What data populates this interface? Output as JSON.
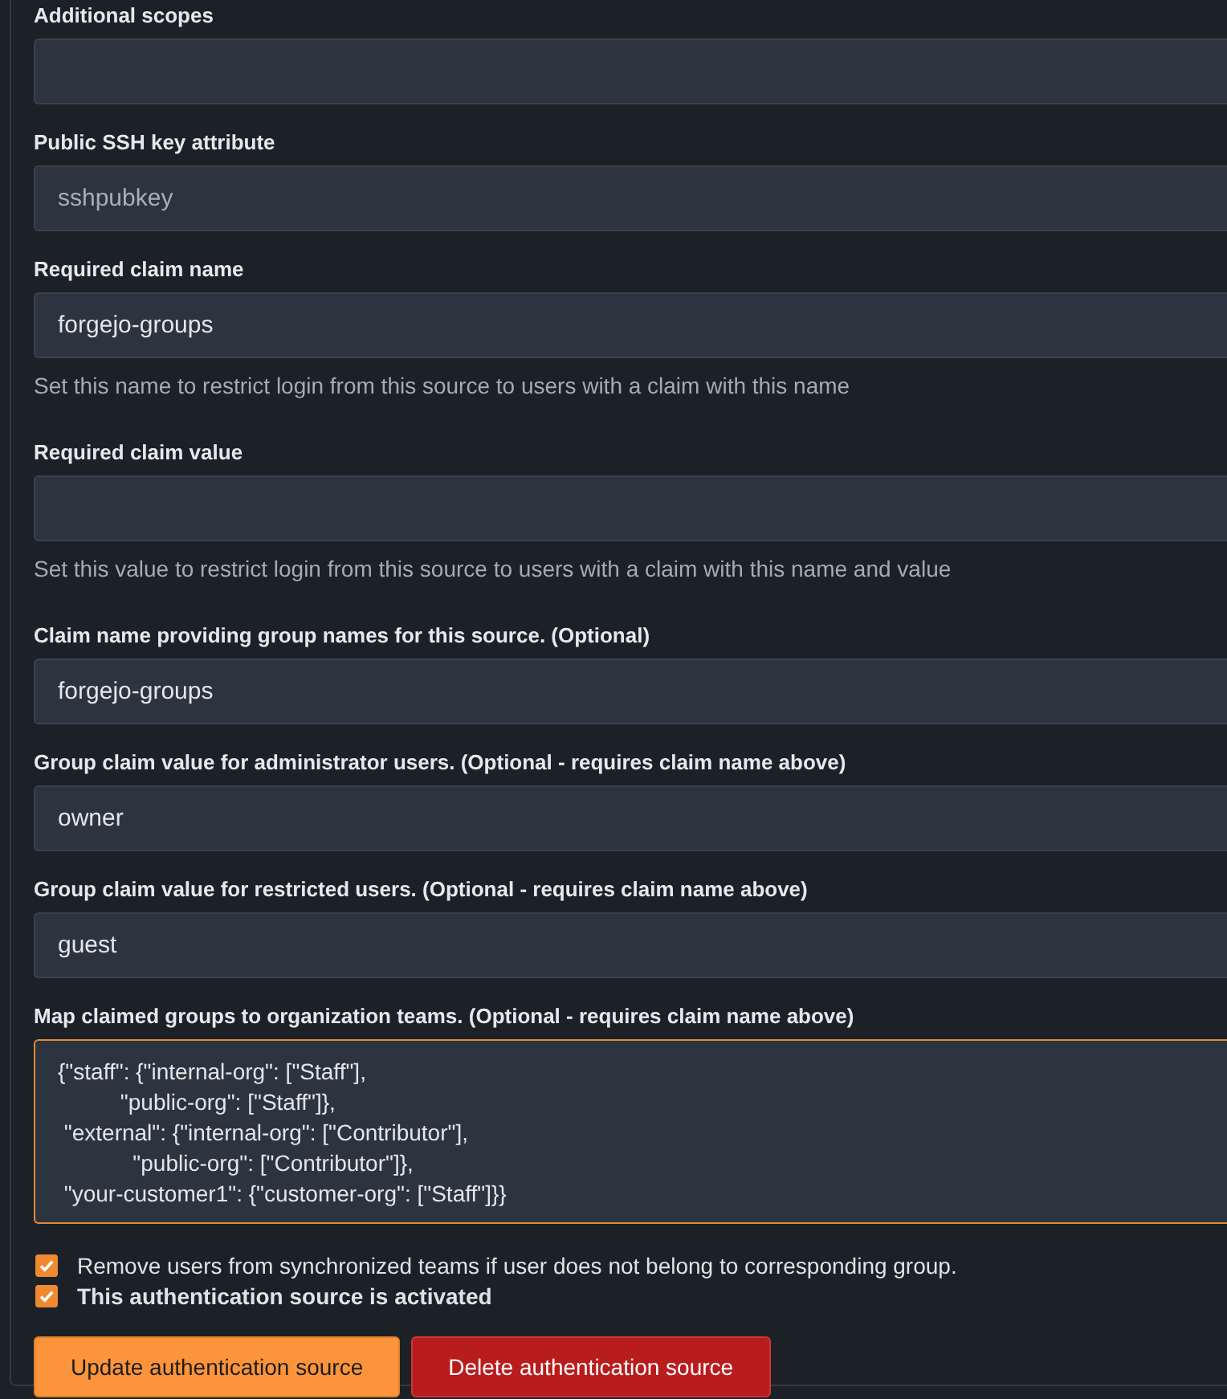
{
  "fields": [
    {
      "kind": "input",
      "label": "Additional scopes"
    },
    {
      "kind": "input",
      "label": "Public SSH key attribute",
      "placeholder": "sshpubkey"
    },
    {
      "kind": "input",
      "label": "Required claim name",
      "value": "forgejo-groups",
      "help": "Set this name to restrict login from this source to users with a claim with this name"
    },
    {
      "kind": "input",
      "label": "Required claim value",
      "help": "Set this value to restrict login from this source to users with a claim with this name and value"
    },
    {
      "kind": "input",
      "label": "Claim name providing group names for this source. (Optional)",
      "value": "forgejo-groups"
    },
    {
      "kind": "input",
      "label": "Group claim value for administrator users. (Optional - requires claim name above)",
      "value": "owner"
    },
    {
      "kind": "input",
      "label": "Group claim value for restricted users. (Optional - requires claim name above)",
      "value": "guest"
    },
    {
      "kind": "textarea",
      "label": "Map claimed groups to organization teams. (Optional - requires claim name above)",
      "focused": true,
      "value": "{\"staff\": {\"internal-org\": [\"Staff\"],\n          \"public-org\": [\"Staff\"]},\n \"external\": {\"internal-org\": [\"Contributor\"],\n            \"public-org\": [\"Contributor\"]},\n \"your-customer1\": {\"customer-org\": [\"Staff\"]}}"
    }
  ],
  "checkboxes": [
    {
      "label": "Remove users from synchronized teams if user does not belong to corresponding group.",
      "checked": true,
      "bold": false
    },
    {
      "label": "This authentication source is activated",
      "checked": true,
      "bold": true
    }
  ],
  "buttons": [
    {
      "label": "Update authentication source",
      "kind": "primary"
    },
    {
      "label": "Delete authentication source",
      "kind": "danger"
    }
  ]
}
